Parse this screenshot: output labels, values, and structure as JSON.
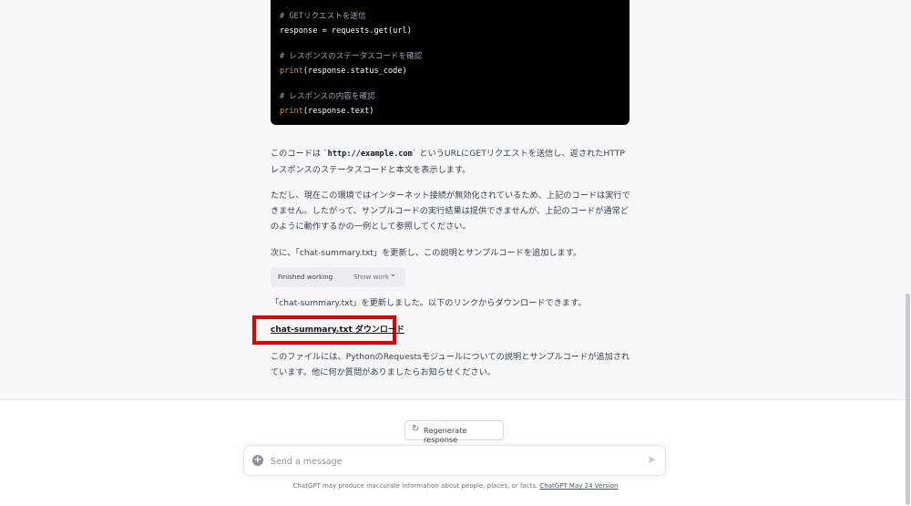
{
  "code": {
    "lines": [
      {
        "type": "comment",
        "text": "# GETリクエストを送信"
      },
      {
        "type": "code",
        "text": "response = requests.get(url)"
      },
      {
        "type": "comment",
        "text": "# レスポンスのステータスコードを確認"
      },
      {
        "type": "print",
        "fn": "print",
        "rest": "(response.status_code)"
      },
      {
        "type": "comment",
        "text": "# レスポンスの内容を確認"
      },
      {
        "type": "print",
        "fn": "print",
        "rest": "(response.text)"
      }
    ]
  },
  "messages": {
    "p1_before": "このコードは `",
    "p1_code": "http://example.com",
    "p1_after": "` というURLにGETリクエストを送信し、返されたHTTPレスポンスのステータスコードと本文を表示します。",
    "p2": "ただし、現在この環境ではインターネット接続が無効化されているため、上記のコードは実行できません。したがって、サンプルコードの実行結果は提供できませんが、上記のコードが通常どのように動作するかの一例として参照してください。",
    "p3": "次に、「chat-summary.txt」を更新し、この説明とサンプルコードを追加します。",
    "working_status": "Finished working",
    "show_work": "Show work",
    "p4": "「chat-summary.txt」を更新しました。以下のリンクからダウンロードできます。",
    "download_link": "chat-summary.txt ダウンロード",
    "p5": "このファイルには、PythonのRequestsモジュールについての説明とサンプルコードが追加されています。他に何か質問がありましたらお知らせください。"
  },
  "composer": {
    "regenerate_label": "Regenerate response",
    "placeholder": "Send a message",
    "disclaimer_text": "ChatGPT may produce inaccurate information about people, places, or facts.",
    "disclaimer_link": "ChatGPT May 24 Version"
  },
  "colors": {
    "highlight": "#e00000",
    "code_bg": "#000000",
    "code_fn": "#e9950c"
  }
}
